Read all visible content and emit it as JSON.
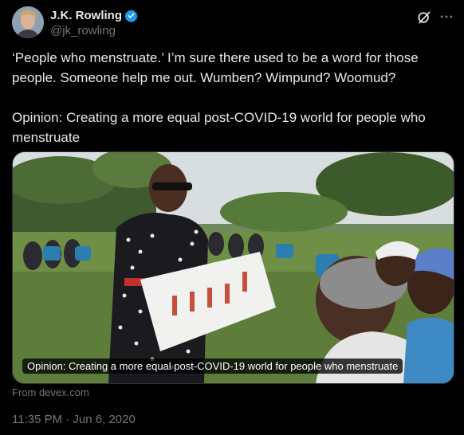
{
  "user": {
    "display_name": "J.K. Rowling",
    "handle": "@jk_rowling"
  },
  "tweet": {
    "text": "‘People who menstruate.’ I’m sure there used to be a word for those people. Someone help me out. Wumben? Wimpund? Woomud?\n\nOpinion: Creating a more equal post-COVID-19 world for people who menstruate"
  },
  "card": {
    "caption": "Opinion: Creating a more equal post-COVID-19 world for people who menstruate",
    "source": "From devex.com"
  },
  "meta": {
    "timestamp": "11:35 PM · Jun 6, 2020"
  },
  "icons": {
    "verified": "verified-badge-icon",
    "grok": "grok-icon",
    "more": "more-icon"
  },
  "colors": {
    "background": "#000000",
    "text": "#e7e9ea",
    "secondary": "#71767b",
    "verified": "#1d9bf0"
  }
}
